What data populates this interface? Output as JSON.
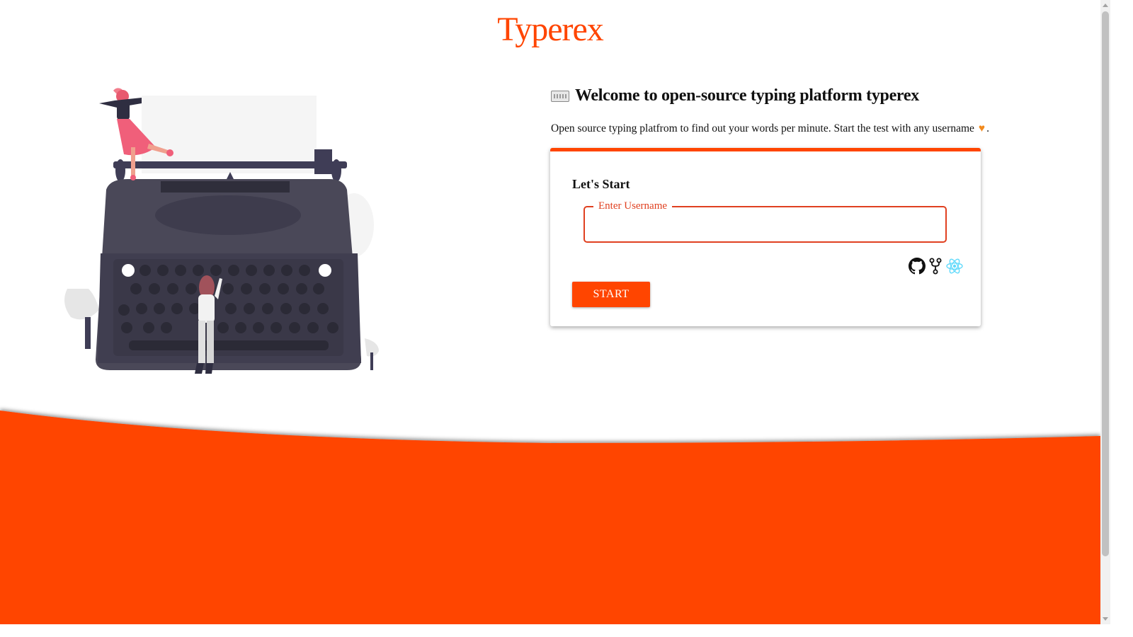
{
  "brand": {
    "title": "Typerex"
  },
  "welcome": {
    "title": "Welcome to open-source typing platform typerex",
    "description": "Open source typing platfrom to find out your words per minute. Start the test with any username",
    "description_end": "."
  },
  "card": {
    "title": "Let's Start",
    "username_label": "Enter Username",
    "username_value": "",
    "start_label": "START"
  },
  "icons": [
    "keyboard-icon",
    "heart-icon",
    "github-icon",
    "git-fork-icon",
    "react-icon"
  ],
  "colors": {
    "accent": "#ff4500",
    "field_border": "#e04020",
    "heart": "#f28a1e",
    "react": "#61dafb"
  }
}
